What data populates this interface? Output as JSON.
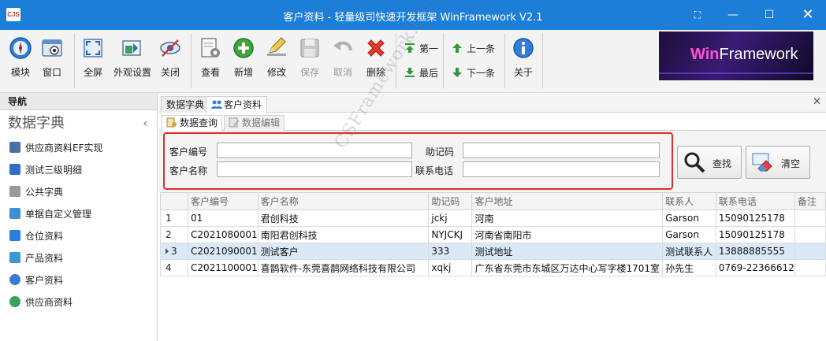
{
  "window": {
    "app_icon_text": "CJS",
    "title": "客户资料 - 轻量级司快速开发框架 WinFramework V2.1",
    "controls": {
      "restore_other": "⛶",
      "minimize": "—",
      "maximize": "☐",
      "close": "✕"
    }
  },
  "toolbar": {
    "buttons": [
      {
        "label": "模块",
        "icon": "compass-icon"
      },
      {
        "label": "窗口",
        "icon": "window-icon"
      },
      {
        "label": "全屏",
        "icon": "fullscreen-icon"
      },
      {
        "label": "外观设置",
        "icon": "skin-icon"
      },
      {
        "label": "关闭",
        "icon": "eye-off-icon"
      },
      {
        "label": "查看",
        "icon": "document-gear-icon"
      },
      {
        "label": "新增",
        "icon": "plus-circle-icon"
      },
      {
        "label": "修改",
        "icon": "pencil-icon"
      },
      {
        "label": "保存",
        "icon": "floppy-icon"
      },
      {
        "label": "取消",
        "icon": "undo-icon"
      },
      {
        "label": "删除",
        "icon": "delete-x-icon"
      },
      {
        "label": "关于",
        "icon": "info-icon"
      }
    ],
    "nav_buttons": {
      "first": "第一",
      "last": "最后",
      "prev": "上一条",
      "next": "下一条"
    },
    "logo": {
      "win": "Win",
      "framework": "Framework"
    }
  },
  "nav": {
    "header": "导航",
    "group_title": "数据字典",
    "items": [
      {
        "label": "供应商资料EF实现",
        "icon": "building-icon",
        "color": "#4a6fa5"
      },
      {
        "label": "测试三级明细",
        "icon": "layers-icon",
        "color": "#2f6fc9"
      },
      {
        "label": "公共字典",
        "icon": "cube-icon",
        "color": "#9a9a9a"
      },
      {
        "label": "单据自定义管理",
        "icon": "form-icon",
        "color": "#3a8fd6"
      },
      {
        "label": "仓位资料",
        "icon": "home-icon",
        "color": "#2a7de0"
      },
      {
        "label": "产品资料",
        "icon": "box-icon",
        "color": "#3a9ad6"
      },
      {
        "label": "客户资料",
        "icon": "users-icon",
        "color": "#3a7bd5"
      },
      {
        "label": "供应商资料",
        "icon": "supplier-icon",
        "color": "#3aa35a"
      }
    ]
  },
  "doc_tabs": [
    {
      "label": "数据字典",
      "active": false
    },
    {
      "label": "客户资料",
      "active": true
    }
  ],
  "sub_tabs": [
    {
      "label": "数据查询",
      "active": true
    },
    {
      "label": "数据编辑",
      "active": false
    }
  ],
  "search": {
    "customer_code_label": "客户编号",
    "customer_code_value": "",
    "customer_name_label": "客户名称",
    "customer_name_value": "",
    "mnemonic_label": "助记码",
    "mnemonic_value": "",
    "phone_label": "联系电话",
    "phone_value": "",
    "search_button": "查找",
    "clear_button": "清空"
  },
  "grid": {
    "columns": [
      "",
      "客户编号",
      "客户名称",
      "助记码",
      "客户地址",
      "联系人",
      "联系电话",
      "备注"
    ],
    "rows": [
      {
        "n": "1",
        "code": "01",
        "name": "君创科技",
        "mnemonic": "jckj",
        "address": "河南",
        "contact": "Garson",
        "phone": "15090125178",
        "note": ""
      },
      {
        "n": "2",
        "code": "C2021080001",
        "name": "南阳君创科技",
        "mnemonic": "NYJCKJ",
        "address": "河南省南阳市",
        "contact": "Garson",
        "phone": "15090125178",
        "note": ""
      },
      {
        "n": "3",
        "code": "C2021090001",
        "name": "测试客户",
        "mnemonic": "333",
        "address": "测试地址",
        "contact": "测试联系人",
        "phone": "13888885555",
        "note": ""
      },
      {
        "n": "4",
        "code": "C2021100001",
        "name": "喜鹊软件-东莞喜鹊网络科技有限公司",
        "mnemonic": "xqkj",
        "address": "广东省东莞市东城区万达中心写字楼1701室",
        "contact": "孙先生",
        "phone": "0769-22366612",
        "note": ""
      }
    ],
    "selected_row": 3
  },
  "watermark": "CSFramework.COM",
  "colors": {
    "titlebar": "#1c7ed6",
    "highlight_box": "#d9302c",
    "selected_row": "#dbe9f7"
  }
}
